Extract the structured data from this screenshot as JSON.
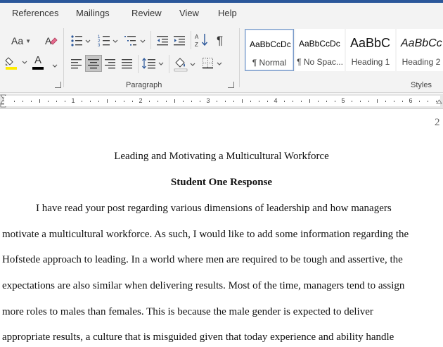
{
  "tabs": [
    "References",
    "Mailings",
    "Review",
    "View",
    "Help"
  ],
  "font_group": {
    "change_case_label": "Aa",
    "font_color_label": "A",
    "highlight_color": "#ffeb00",
    "font_color": "#000000"
  },
  "paragraph_group": {
    "label": "Paragraph",
    "sort_label": "A Z",
    "pilcrow_label": "¶"
  },
  "styles_group": {
    "label": "Styles",
    "items": [
      {
        "preview": "AaBbCcDc",
        "name": "¶ Normal",
        "selected": true
      },
      {
        "preview": "AaBbCcDc",
        "name": "¶ No Spac..."
      },
      {
        "preview": "AaBbC",
        "name": "Heading 1"
      },
      {
        "preview": "AaBbCc",
        "name": "Heading 2"
      }
    ]
  },
  "ruler": {
    "numbers": [
      "1",
      "2",
      "3",
      "4",
      "5",
      "6"
    ]
  },
  "document": {
    "page_number": "2",
    "title": "Leading and Motivating a Multicultural Workforce",
    "subtitle": "Student One Response",
    "lines": [
      "I have read your post regarding various dimensions of leadership and how managers",
      "motivate a multicultural workforce. As such, I would like to add some information regarding the",
      "Hofstede approach to leading. In a world where men are required to be tough and assertive, the",
      "expectations are also similar when delivering results. Most of the time, managers tend to assign",
      "more roles to males than females. This is because the male gender is expected to deliver",
      "appropriate results, a culture that is misguided given that today experience and ability handle"
    ]
  }
}
